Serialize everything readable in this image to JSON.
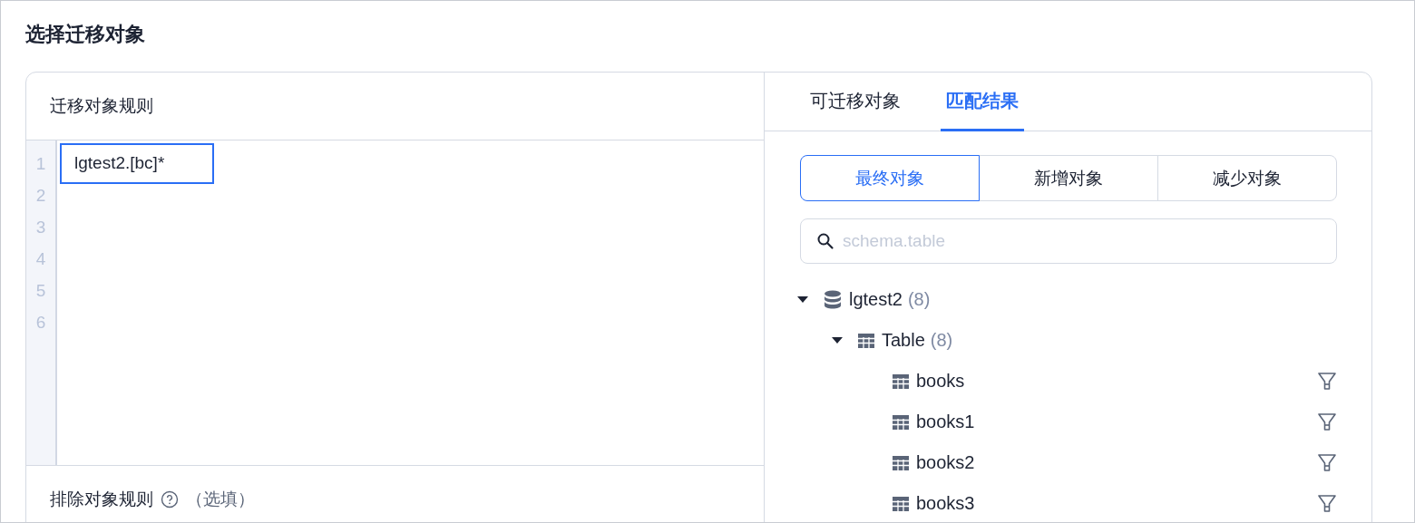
{
  "title": "选择迁移对象",
  "rules_panel": {
    "title": "迁移对象规则",
    "editor": {
      "line_numbers": [
        "1",
        "2",
        "3",
        "4",
        "5",
        "6"
      ],
      "value": "lgtest2.[bc]*"
    },
    "exclude_rule": {
      "label": "排除对象规则",
      "optional": "（选填）"
    }
  },
  "result_panel": {
    "tabs": [
      {
        "label": "可迁移对象",
        "selected": false
      },
      {
        "label": "匹配结果",
        "selected": true
      }
    ],
    "segments": [
      {
        "label": "最终对象",
        "selected": true
      },
      {
        "label": "新增对象",
        "selected": false
      },
      {
        "label": "减少对象",
        "selected": false
      }
    ],
    "search": {
      "placeholder": "schema.table"
    },
    "tree": [
      {
        "kind": "database",
        "label": "lgtest2",
        "count": "(8)",
        "expanded": true,
        "children": [
          {
            "kind": "group",
            "label": "Table",
            "count": "(8)",
            "expanded": true,
            "children": [
              {
                "kind": "table",
                "label": "books"
              },
              {
                "kind": "table",
                "label": "books1"
              },
              {
                "kind": "table",
                "label": "books2"
              },
              {
                "kind": "table",
                "label": "books3"
              }
            ]
          }
        ]
      }
    ]
  }
}
